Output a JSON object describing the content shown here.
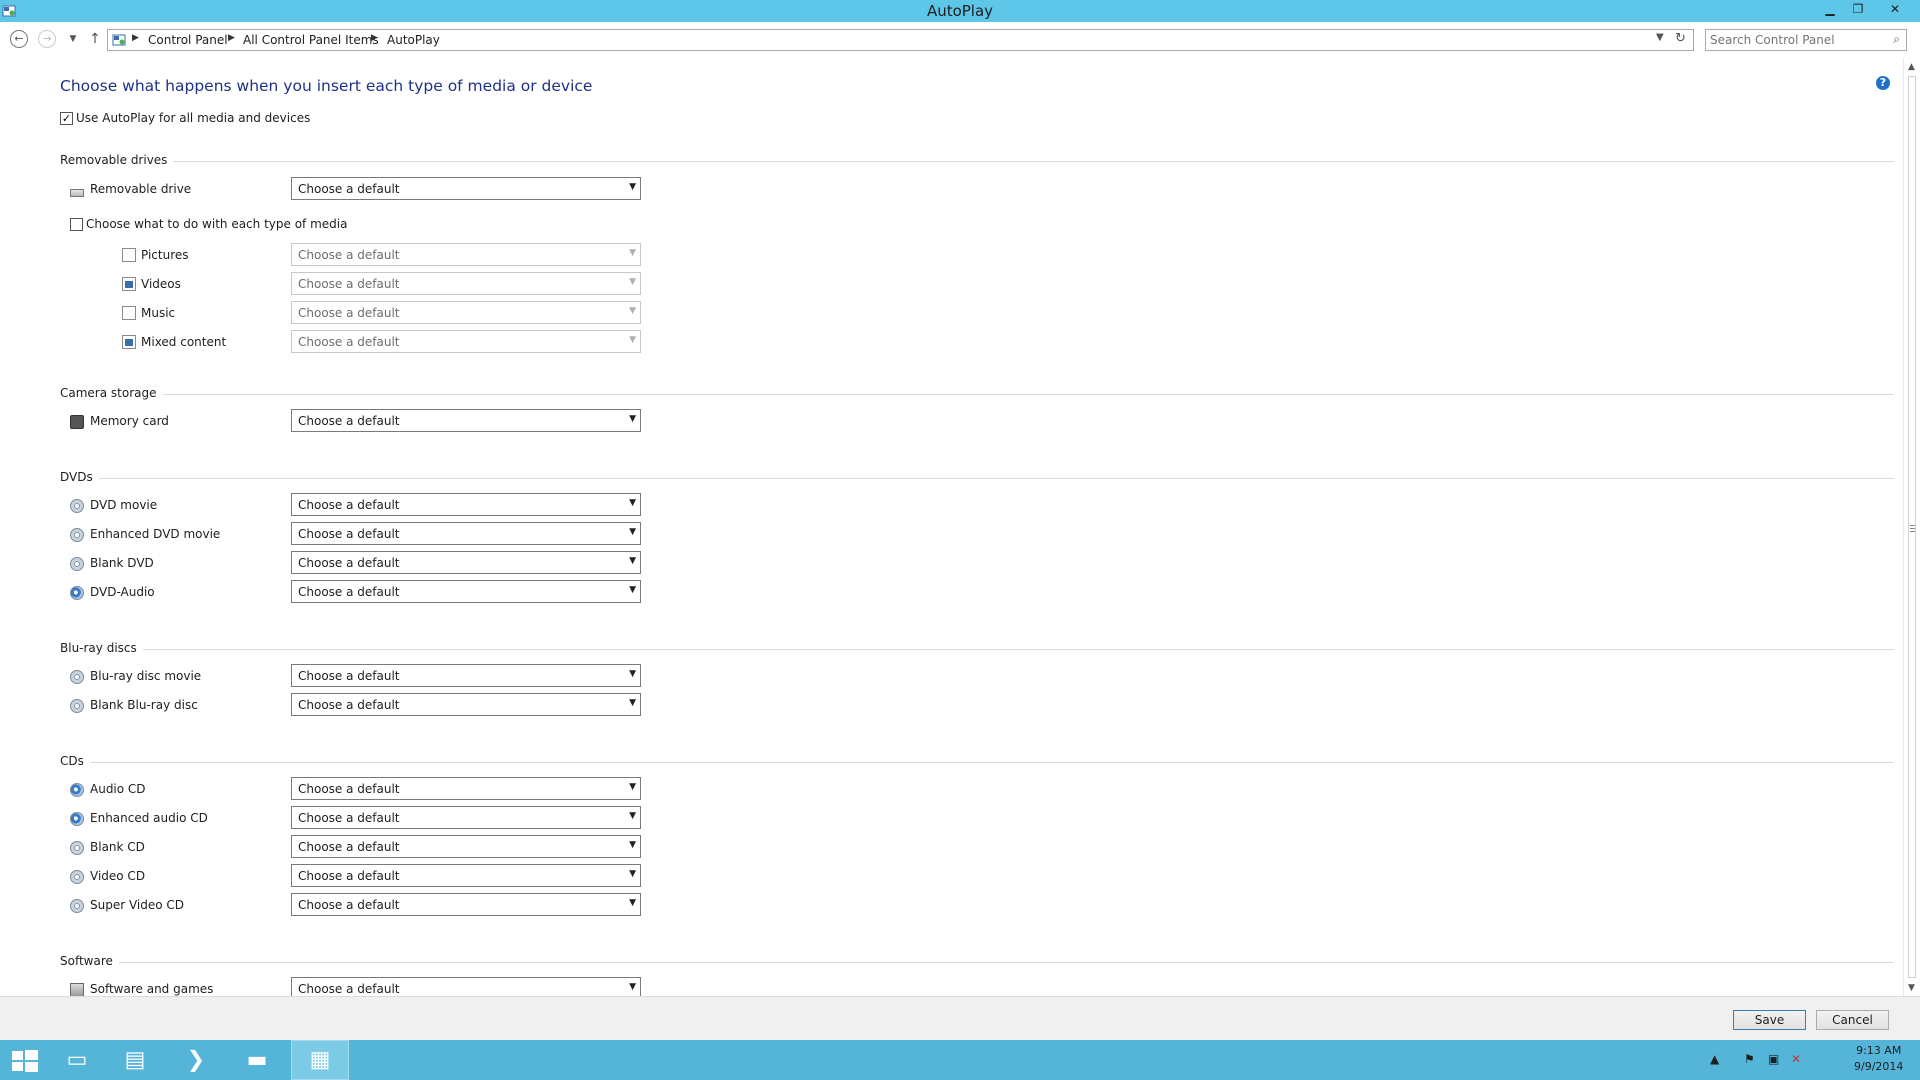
{
  "window": {
    "title": "AutoPlay"
  },
  "address_bar": {
    "crumbs": [
      "Control Panel",
      "All Control Panel Items",
      "AutoPlay"
    ],
    "search_placeholder": "Search Control Panel"
  },
  "main": {
    "heading": "Choose what happens when you insert each type of media or device",
    "use_autoplay": {
      "label": "Use AutoPlay for all media and devices",
      "checked": true
    },
    "default_option": "Choose a default",
    "sections": {
      "removable": {
        "header": "Removable drives",
        "drive_label": "Removable drive",
        "per_media": {
          "label": "Choose what to do with each type of media",
          "checked": false
        },
        "media": [
          "Pictures",
          "Videos",
          "Music",
          "Mixed content"
        ]
      },
      "camera": {
        "header": "Camera storage",
        "items": [
          "Memory card"
        ]
      },
      "dvds": {
        "header": "DVDs",
        "items": [
          "DVD movie",
          "Enhanced DVD movie",
          "Blank DVD",
          "DVD-Audio"
        ]
      },
      "bluray": {
        "header": "Blu-ray discs",
        "items": [
          "Blu-ray disc movie",
          "Blank Blu-ray disc"
        ]
      },
      "cds": {
        "header": "CDs",
        "items": [
          "Audio CD",
          "Enhanced audio CD",
          "Blank CD",
          "Video CD",
          "Super Video CD"
        ]
      },
      "software": {
        "header": "Software",
        "items": [
          "Software and games"
        ]
      }
    }
  },
  "footer": {
    "save_label": "Save",
    "cancel_label": "Cancel"
  },
  "taskbar": {
    "clock_time": "9:13 AM",
    "clock_date": "9/9/2014",
    "colors": {
      "taskbar": "#54b5d9",
      "titlebar": "#5ec6e8",
      "heading": "#1e3287"
    }
  }
}
